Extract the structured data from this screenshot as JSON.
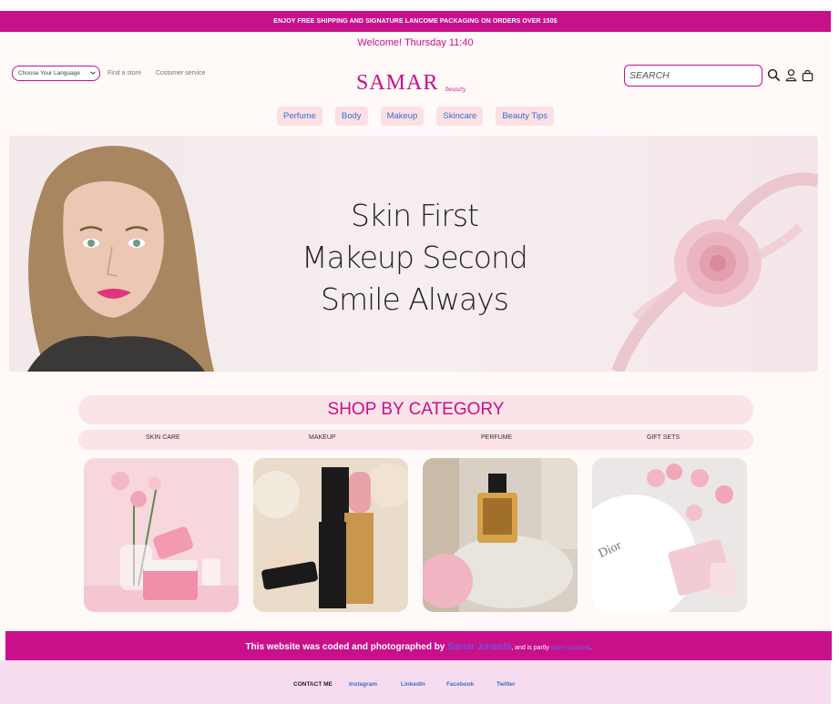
{
  "promo": {
    "text": "ENJOY FREE SHIPPING AND SIGNATURE LANCOME PACKAGING ON ORDERS OVER 150$"
  },
  "welcome": {
    "text": "Welcome! Thursday 11:40"
  },
  "topbar": {
    "language_select": "Choose Your Language",
    "find_store": "Find a store",
    "customer_service": "Costumer service"
  },
  "logo": {
    "name": "SAMAR",
    "sub": "beauty"
  },
  "search": {
    "placeholder": "SEARCH"
  },
  "icons": {
    "search": "search-icon",
    "user": "user-icon",
    "bag": "shopping-bag-icon"
  },
  "nav": {
    "items": [
      "Perfume",
      "Body",
      "Makeup",
      "Skincare",
      "Beauty Tips"
    ]
  },
  "hero": {
    "line1": "Skin First",
    "line2": "Makeup Second",
    "line3": "Smile Always"
  },
  "category": {
    "title": "SHOP BY CATEGORY",
    "tabs": [
      "SKIN CARE",
      "MAKEUP",
      "PERFUME",
      "GIFT SETS"
    ]
  },
  "footer": {
    "credit_prefix": "This website was coded and photographed by ",
    "author": "Samar Joharchi",
    "credit_middle": ", and is partly ",
    "opensource": "open-sourced",
    "credit_end": ".",
    "contact_label": "CONTACT ME",
    "links": [
      "Instagram",
      "LinkedIn",
      "Facebook",
      "Twitter"
    ]
  },
  "colors": {
    "brand": "#c8108a",
    "link": "#3a6fd0",
    "nav_bg": "#fbe0e4",
    "footer_bg": "#f7dcf0"
  }
}
